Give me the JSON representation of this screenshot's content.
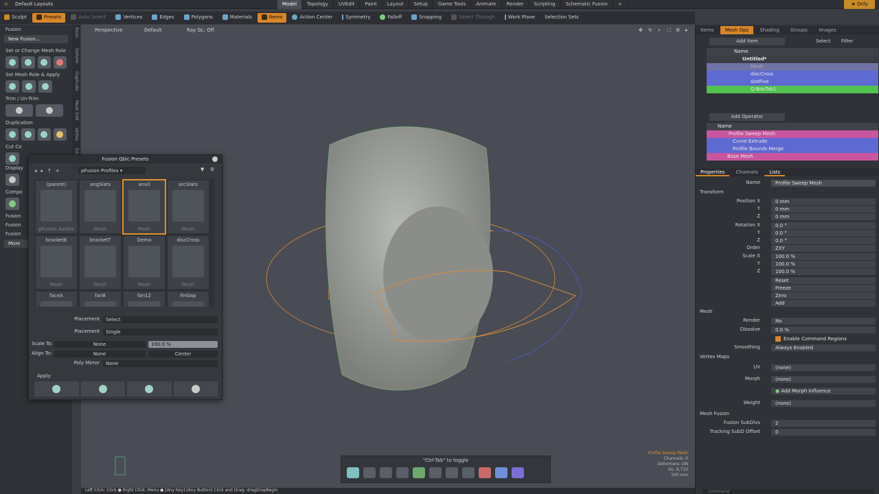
{
  "menubar": {
    "layout": "Default Layouts",
    "tabs": [
      "Model",
      "Topology",
      "UVEdit",
      "Paint",
      "Layout",
      "Setup",
      "Game Tools",
      "Animate",
      "Render",
      "Scripting",
      "Schematic Fusion"
    ],
    "active_tab": "Model",
    "only_label": "Only"
  },
  "toolbar": {
    "sculpt": "Sculpt",
    "presets": "Presets",
    "auto_select": "Auto Select",
    "vertices": "Vertices",
    "edges": "Edges",
    "polygons": "Polygons",
    "materials": "Materials",
    "items": "Items",
    "action_center": "Action Center",
    "symmetry": "Symmetry",
    "falloff": "Falloff",
    "snapping": "Snapping",
    "select_through": "Select Through",
    "work_plane": "Work Plane",
    "selection_sets": "Selection Sets"
  },
  "leftpanel": {
    "fusion": "Fusion",
    "new_fusion": "New Fusion...",
    "set_role": "Set or Change Mesh Role",
    "set_role_apply": "Set Mesh Role & Apply",
    "trim": "Trim / Un-Trim",
    "duplication": "Duplication",
    "cut": "Cut Co",
    "display": "Display",
    "compo": "Compo",
    "fusion_a": "Fusion",
    "fusion_b": "Fusion",
    "fusion_c": "Fusion",
    "more": "More"
  },
  "vtabs": [
    "Basic",
    "Deform",
    "Duplicate",
    "Mesh Edit",
    "Vertex",
    "Edge"
  ],
  "viewport": {
    "view": "Perspective",
    "shading": "Default",
    "raygl": "Ray GL: Off"
  },
  "presets": {
    "title": "Fusion Qbic Presets",
    "path": "pFusion Profiles",
    "cells": [
      {
        "label": "(parent)",
        "type": "pFusion Assets"
      },
      {
        "label": "angSlats",
        "type": "Mesh"
      },
      {
        "label": "anvil",
        "type": "Mesh"
      },
      {
        "label": "arcSlats",
        "type": "Mesh"
      },
      {
        "label": "bracketE",
        "type": "Mesh"
      },
      {
        "label": "bracketT",
        "type": "Mesh"
      },
      {
        "label": "Demo",
        "type": "Mesh"
      },
      {
        "label": "discCross",
        "type": "Mesh"
      },
      {
        "label": "faceA",
        "type": ""
      },
      {
        "label": "fan8",
        "type": ""
      },
      {
        "label": "fan12",
        "type": ""
      },
      {
        "label": "finGap",
        "type": ""
      }
    ],
    "placement1_label": "Placement",
    "placement1": "Select",
    "placement2_label": "Placement",
    "placement2": "Single",
    "scale_to_label": "Scale To:",
    "scale_to": "None",
    "scale_pct": "100.0 %",
    "align_to_label": "Align To:",
    "align_to": "None",
    "align_center": "Center",
    "poly_mirror_label": "Poly Mirror",
    "poly_mirror": "None",
    "apply": "Apply"
  },
  "items_panel": {
    "tabs": [
      "Items",
      "Mesh Ops",
      "Shading",
      "Groups",
      "Images"
    ],
    "active": "Mesh Ops",
    "add_item": "Add Item",
    "select": "Select",
    "filter": "Filter",
    "col_name": "Name",
    "rows": [
      {
        "label": "Untitled*",
        "color": "#3a3d43"
      },
      {
        "label": "Mesh",
        "color": "#6f73a6"
      },
      {
        "label": "discCross",
        "color": "#5e6ad1"
      },
      {
        "label": "slotFive",
        "color": "#5e6ad1"
      },
      {
        "label": "Q-BoxTab1",
        "color": "#52c24f"
      }
    ]
  },
  "ops_panel": {
    "add_operator": "Add Operator",
    "col_name": "Name",
    "rows": [
      {
        "label": "Profile Sweep Mesh",
        "color": "#c8559e"
      },
      {
        "label": "Curve Extrude",
        "color": "#5e6ad1"
      },
      {
        "label": "Profile Bounds Merge",
        "color": "#5e6ad1"
      },
      {
        "label": "Base Mesh",
        "color": "#c8559e"
      }
    ]
  },
  "props": {
    "tabs": [
      "Properties",
      "Channels",
      "Lists"
    ],
    "name_label": "Name",
    "name": "Profile Sweep Mesh",
    "transform": "Transform",
    "position_label": "Position X",
    "pos": [
      "0 mm",
      "0 mm",
      "0 mm"
    ],
    "rotation_label": "Rotation X",
    "rot": [
      "0.0 °",
      "0.0 °",
      "0.0 °"
    ],
    "order_label": "Order",
    "order": "ZXY",
    "scale_label": "Scale X",
    "scale": [
      "100.0 %",
      "100.0 %",
      "100.0 %"
    ],
    "y": "Y",
    "z": "Z",
    "reset": "Reset",
    "freeze": "Freeze",
    "zero": "Zero",
    "add": "Add",
    "mesh": "Mesh",
    "render_label": "Render",
    "render": "No",
    "dissolve_label": "Dissolve",
    "dissolve": "0.0 %",
    "enable_cmd": "Enable Command Regions",
    "smoothing_label": "Smoothing",
    "smoothing": "Always Enabled",
    "vertex_maps": "Vertex Maps",
    "uv_label": "UV",
    "uv": "(none)",
    "morph_label": "Morph",
    "morph": "(none)",
    "add_morph": "Add Morph Influence",
    "weight_label": "Weight",
    "weight": "(none)",
    "mesh_fusion": "Mesh Fusion",
    "subdivs_label": "Fusion SubDivs",
    "subdivs": "2",
    "tracking_label": "Tracking SubD Offset",
    "tracking": "0"
  },
  "right_vtabs": [
    "Mesh",
    "Surface",
    "Curve",
    "Display",
    "Assembly",
    "User Channels",
    "Tags"
  ],
  "info": {
    "name": "Profile Sweep Mesh",
    "channels": "Channels: 0",
    "deformers": "Deformers: ON",
    "gl": "GL: 8,710",
    "size": "100 mm"
  },
  "toggle": {
    "text": "\"Ctrl-Tab\" to toggle"
  },
  "status": "Left Click: Click ● Right Click: Menu ● [Any Key]-[Any Button] Click and Drag: dragDropBegin",
  "command": "Command"
}
